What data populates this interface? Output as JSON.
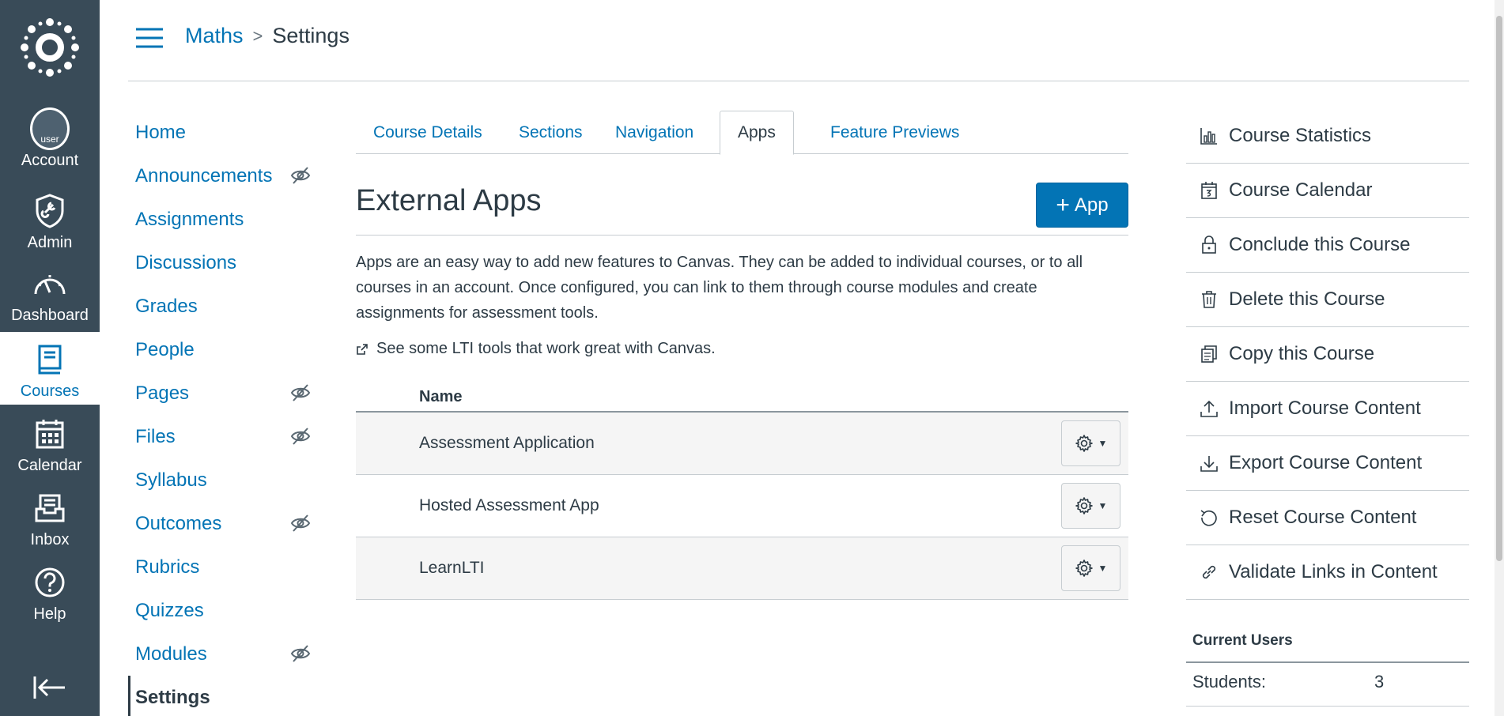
{
  "global_nav": {
    "logo": "canvas-logo",
    "avatar_alt": "user",
    "items": [
      {
        "label": "Account",
        "icon": "avatar"
      },
      {
        "label": "Admin",
        "icon": "shield-icon"
      },
      {
        "label": "Dashboard",
        "icon": "dashboard-icon"
      },
      {
        "label": "Courses",
        "icon": "book-icon"
      },
      {
        "label": "Calendar",
        "icon": "calendar-icon"
      },
      {
        "label": "Inbox",
        "icon": "inbox-icon"
      },
      {
        "label": "Help",
        "icon": "help-icon"
      }
    ],
    "active": "Courses"
  },
  "breadcrumb": {
    "course": "Maths",
    "separator": ">",
    "current": "Settings"
  },
  "course_nav": {
    "items": [
      {
        "label": "Home",
        "hidden": false
      },
      {
        "label": "Announcements",
        "hidden": true
      },
      {
        "label": "Assignments",
        "hidden": false
      },
      {
        "label": "Discussions",
        "hidden": false
      },
      {
        "label": "Grades",
        "hidden": false
      },
      {
        "label": "People",
        "hidden": false
      },
      {
        "label": "Pages",
        "hidden": true
      },
      {
        "label": "Files",
        "hidden": true
      },
      {
        "label": "Syllabus",
        "hidden": false
      },
      {
        "label": "Outcomes",
        "hidden": true
      },
      {
        "label": "Rubrics",
        "hidden": false
      },
      {
        "label": "Quizzes",
        "hidden": false
      },
      {
        "label": "Modules",
        "hidden": true
      },
      {
        "label": "Settings",
        "hidden": false
      }
    ],
    "active": "Settings"
  },
  "tabs": [
    {
      "label": "Course Details"
    },
    {
      "label": "Sections"
    },
    {
      "label": "Navigation"
    },
    {
      "label": "Apps"
    },
    {
      "label": "Feature Previews"
    }
  ],
  "active_tab": "Apps",
  "main": {
    "title": "External Apps",
    "add_button_label": "App",
    "description": "Apps are an easy way to add new features to Canvas. They can be added to individual courses, or to all courses in an account. Once configured, you can link to them through course modules and create assignments for assessment tools.",
    "lti_link": "See some LTI tools that work great with Canvas.",
    "table": {
      "column_header": "Name",
      "rows": [
        {
          "name": "Assessment Application"
        },
        {
          "name": "Hosted Assessment App"
        },
        {
          "name": "LearnLTI"
        }
      ]
    }
  },
  "sidebar": {
    "links": [
      {
        "label": "Course Statistics",
        "icon": "stats-icon"
      },
      {
        "label": "Course Calendar",
        "icon": "calendar-icon"
      },
      {
        "label": "Conclude this Course",
        "icon": "lock-icon"
      },
      {
        "label": "Delete this Course",
        "icon": "trash-icon"
      },
      {
        "label": "Copy this Course",
        "icon": "copy-icon"
      },
      {
        "label": "Import Course Content",
        "icon": "upload-icon"
      },
      {
        "label": "Export Course Content",
        "icon": "download-icon"
      },
      {
        "label": "Reset Course Content",
        "icon": "reset-icon"
      },
      {
        "label": "Validate Links in Content",
        "icon": "link-icon"
      }
    ],
    "current_users": {
      "title": "Current Users",
      "rows": [
        {
          "label": "Students:",
          "value": "3"
        }
      ]
    }
  },
  "colors": {
    "nav_bg": "#394b58",
    "link": "#0374b5",
    "text": "#2d3b45",
    "button": "#0374b5"
  }
}
